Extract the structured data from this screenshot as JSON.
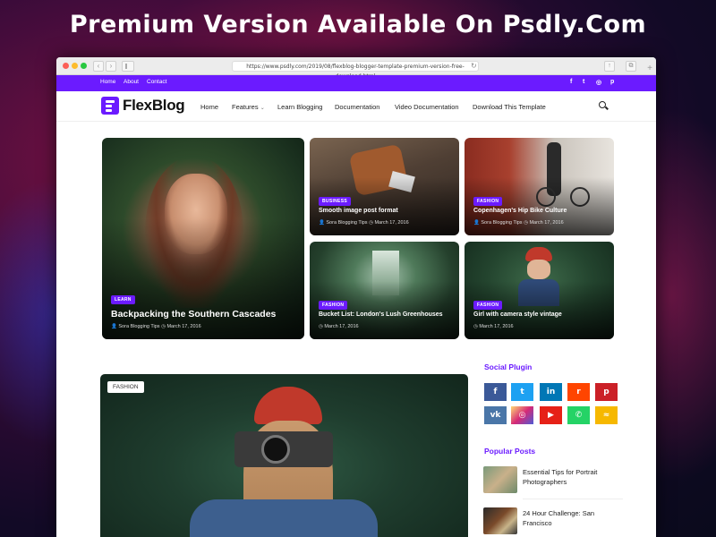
{
  "banner": {
    "headline": "Premium Version Available On Psdly.Com"
  },
  "browser": {
    "url": "https://www.psdly.com/2019/08/flexblog-blogger-template-premium-version-free-download.html"
  },
  "topbar": {
    "links": [
      "Home",
      "About",
      "Contact"
    ],
    "social_icons": [
      "facebook-icon",
      "twitter-icon",
      "instagram-icon",
      "pinterest-icon"
    ]
  },
  "nav": {
    "logo": "FlexBlog",
    "items": [
      "Home",
      "Features",
      "Learn Blogging",
      "Documentation",
      "Video Documentation",
      "Download This Template"
    ]
  },
  "featured": [
    {
      "tag": "LEARN",
      "title": "Backpacking the Southern Cascades",
      "author": "Sora Blogging Tips",
      "date": "March 17, 2016"
    },
    {
      "tag": "BUSINESS",
      "title": "Smooth image post format",
      "author": "Sora Blogging Tips",
      "date": "March 17, 2016"
    },
    {
      "tag": "FASHION",
      "title": "Copenhagen's Hip Bike Culture",
      "author": "Sora Blogging Tips",
      "date": "March 17, 2016"
    },
    {
      "tag": "FASHION",
      "title": "Bucket List: London's Lush Greenhouses",
      "author": "",
      "date": "March 17, 2016"
    },
    {
      "tag": "FASHION",
      "title": "Girl with camera style vintage",
      "author": "",
      "date": "March 17, 2016"
    }
  ],
  "main_post": {
    "tag": "FASHION"
  },
  "sidebar": {
    "social_heading": "Social Plugin",
    "social_buttons": [
      {
        "name": "facebook",
        "glyph": "f",
        "color": "#3b5998"
      },
      {
        "name": "twitter",
        "glyph": "t",
        "color": "#1da1f2"
      },
      {
        "name": "linkedin",
        "glyph": "in",
        "color": "#0077b5"
      },
      {
        "name": "reddit",
        "glyph": "r",
        "color": "#ff4500"
      },
      {
        "name": "pinterest",
        "glyph": "p",
        "color": "#cb2027"
      },
      {
        "name": "vk",
        "glyph": "vk",
        "color": "#4a76a8"
      },
      {
        "name": "instagram",
        "glyph": "◎",
        "color": "#c13584"
      },
      {
        "name": "youtube",
        "glyph": "▶",
        "color": "#e62117"
      },
      {
        "name": "whatsapp",
        "glyph": "✆",
        "color": "#25d366"
      },
      {
        "name": "rss",
        "glyph": "≈",
        "color": "#f6b800"
      }
    ],
    "popular_heading": "Popular Posts",
    "popular_posts": [
      {
        "title": "Essential Tips for Portrait Photographers"
      },
      {
        "title": "24 Hour Challenge: San Francisco"
      }
    ]
  },
  "colors": {
    "accent": "#6b1bff"
  }
}
